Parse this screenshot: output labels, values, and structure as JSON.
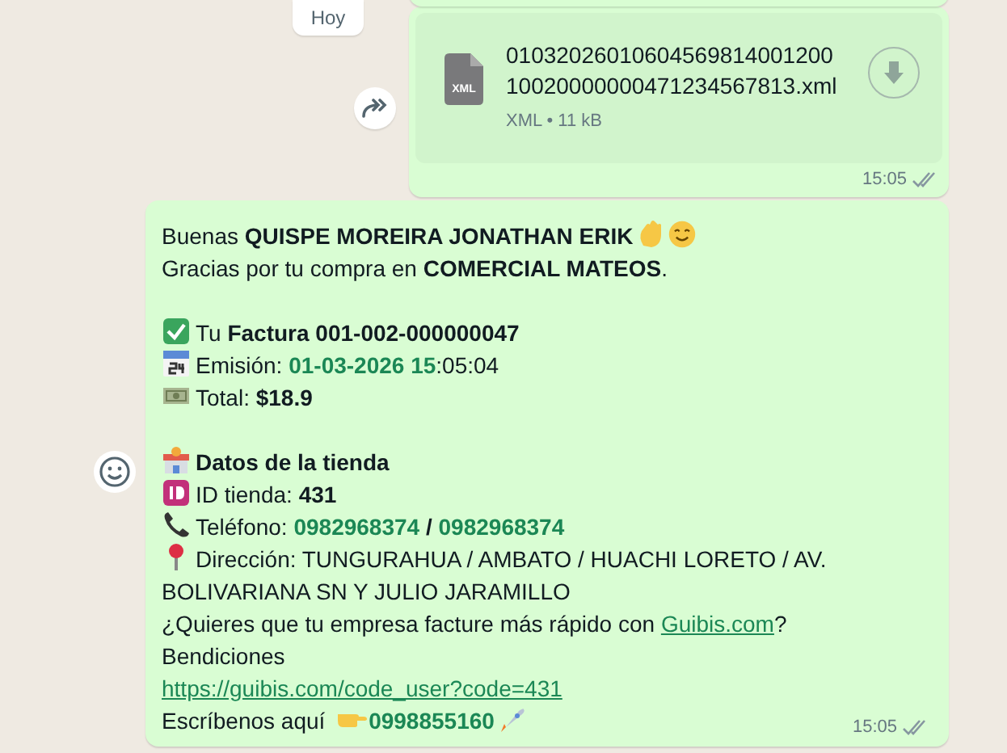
{
  "date_chip": "Hoy",
  "file_message": {
    "file_type": "XML",
    "file_name_lines": [
      "01032026010604569814001200",
      "10020000000471234567813.xml"
    ],
    "meta": "XML • 11 kB",
    "time": "15:05",
    "read": false
  },
  "text_message": {
    "time": "15:05",
    "read": false,
    "lines": [
      {
        "kind": "text",
        "segments": [
          {
            "kind": "plain",
            "text": "Buenas "
          },
          {
            "kind": "bold",
            "text": "QUISPE MOREIRA JONATHAN ERIK"
          },
          {
            "kind": "wave"
          },
          {
            "kind": "smile"
          }
        ]
      },
      {
        "kind": "text",
        "segments": [
          {
            "kind": "plain",
            "text": "Gracias por tu compra en "
          },
          {
            "kind": "bold",
            "text": "COMERCIAL MATEOS"
          },
          {
            "kind": "plain",
            "text": "."
          }
        ]
      },
      {
        "kind": "blank"
      },
      {
        "kind": "check",
        "segments": [
          {
            "kind": "plain",
            "text": "Tu "
          },
          {
            "kind": "bold",
            "text": "Factura 001-002-000000047"
          }
        ]
      },
      {
        "kind": "calendar",
        "segments": [
          {
            "kind": "plain",
            "text": "Emisión: "
          },
          {
            "kind": "green",
            "text": "01-03-2026 15"
          },
          {
            "kind": "plain",
            "text": ":05:04"
          }
        ]
      },
      {
        "kind": "money",
        "segments": [
          {
            "kind": "plain",
            "text": "Total: "
          },
          {
            "kind": "bold",
            "text": "$18.9"
          }
        ]
      },
      {
        "kind": "blank"
      },
      {
        "kind": "store",
        "segments": [
          {
            "kind": "bold",
            "text": "Datos de la tienda"
          }
        ]
      },
      {
        "kind": "id",
        "segments": [
          {
            "kind": "plain",
            "text": "ID tienda: "
          },
          {
            "kind": "bold",
            "text": "431"
          }
        ]
      },
      {
        "kind": "phone",
        "segments": [
          {
            "kind": "plain",
            "text": "Teléfono: "
          },
          {
            "kind": "green",
            "text": "0982968374"
          },
          {
            "kind": "bold",
            "text": " / "
          },
          {
            "kind": "green",
            "text": "0982968374"
          }
        ]
      },
      {
        "kind": "pin",
        "segments": [
          {
            "kind": "plain",
            "text": "Dirección: TUNGURAHUA / AMBATO / HUACHI LORETO / AV."
          }
        ]
      },
      {
        "kind": "text",
        "segments": [
          {
            "kind": "plain",
            "text": "BOLIVARIANA SN Y JULIO JARAMILLO"
          }
        ]
      },
      {
        "kind": "text",
        "segments": [
          {
            "kind": "plain",
            "text": "¿Quieres que tu empresa facture más rápido con "
          },
          {
            "kind": "link",
            "text": "Guibis.com"
          },
          {
            "kind": "plain",
            "text": "?"
          }
        ]
      },
      {
        "kind": "text",
        "segments": [
          {
            "kind": "plain",
            "text": "Bendiciones"
          }
        ]
      },
      {
        "kind": "text",
        "segments": [
          {
            "kind": "link",
            "text": "https://guibis.com/code_user?code=431"
          }
        ]
      },
      {
        "kind": "text",
        "segments": [
          {
            "kind": "plain",
            "text": "Escríbenos aquí "
          },
          {
            "kind": "pointing"
          },
          {
            "kind": "green",
            "text": "0998855160"
          },
          {
            "kind": "rocket"
          }
        ]
      }
    ]
  }
}
